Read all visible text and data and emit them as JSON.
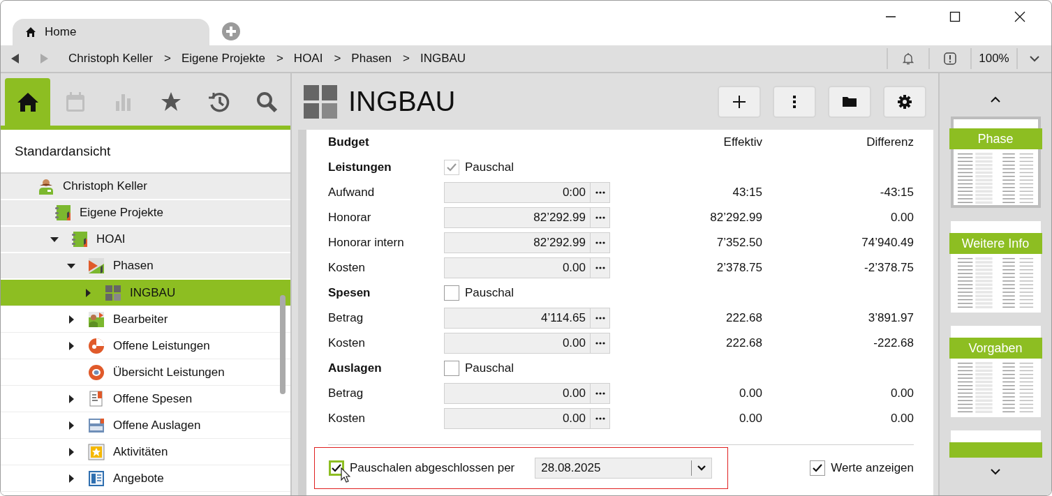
{
  "window": {
    "tabs": [
      {
        "label": "Home",
        "selected": true
      }
    ]
  },
  "breadcrumb": {
    "back_disabled": false,
    "forward_disabled": true,
    "items": [
      {
        "label": "Christoph Keller",
        "separator": ">"
      },
      {
        "label": "Eigene Projekte",
        "separator": ">"
      },
      {
        "label": "HOAI",
        "separator": ">"
      },
      {
        "label": "Phasen",
        "separator": ">"
      },
      {
        "label": "INGBAU"
      }
    ],
    "zoom": "100%"
  },
  "sidebar": {
    "tabs": [
      {
        "kind": "home",
        "selected": true,
        "disabled": false
      },
      {
        "kind": "calendar",
        "selected": false,
        "disabled": true
      },
      {
        "kind": "chart",
        "selected": false,
        "disabled": true
      },
      {
        "kind": "favorites",
        "selected": false,
        "disabled": false
      },
      {
        "kind": "history",
        "selected": false,
        "disabled": false
      },
      {
        "kind": "search",
        "selected": false,
        "disabled": false
      }
    ],
    "view_title": "Standardansicht",
    "tree": [
      {
        "label": "Christoph Keller",
        "kind": "person",
        "selected": false,
        "children": [
          {
            "label": "Eigene Projekte",
            "kind": "project",
            "selected": false,
            "children": [
              {
                "label": "HOAI",
                "kind": "project",
                "expanded": true,
                "selected": false,
                "children": [
                  {
                    "label": "Phasen",
                    "kind": "phases",
                    "expanded": true,
                    "selected": false,
                    "children": [
                      {
                        "label": "INGBAU",
                        "kind": "phase",
                        "expanded": false,
                        "selected": true
                      }
                    ]
                  },
                  {
                    "label": "Bearbeiter",
                    "kind": "staff",
                    "expanded": false,
                    "selected": false
                  },
                  {
                    "label": "Offene Leistungen",
                    "kind": "services",
                    "expanded": false,
                    "selected": false
                  },
                  {
                    "label": "Übersicht Leistungen",
                    "kind": "overview",
                    "selected": false
                  },
                  {
                    "label": "Offene Spesen",
                    "kind": "expenses",
                    "expanded": false,
                    "selected": false
                  },
                  {
                    "label": "Offene Auslagen",
                    "kind": "outlays",
                    "expanded": false,
                    "selected": false
                  },
                  {
                    "label": "Aktivitäten",
                    "kind": "activities",
                    "expanded": false,
                    "selected": false
                  },
                  {
                    "label": "Angebote",
                    "kind": "offers",
                    "expanded": false,
                    "selected": false
                  }
                ]
              }
            ]
          }
        ]
      }
    ]
  },
  "page": {
    "title": "INGBAU",
    "budget": {
      "columns": [
        "Budget",
        "Effektiv",
        "Differenz"
      ],
      "groups": [
        {
          "title": "Leistungen",
          "flat": {
            "label": "Pauschal",
            "checked": true,
            "disabled": true
          },
          "rows": [
            {
              "label": "Aufwand",
              "value": "0:00",
              "effective": "43:15",
              "difference": "-43:15"
            },
            {
              "label": "Honorar",
              "value": "82’292.99",
              "effective": "82’292.99",
              "difference": "0.00"
            },
            {
              "label": "Honorar intern",
              "value": "82’292.99",
              "effective": "7’352.50",
              "difference": "74’940.49"
            },
            {
              "label": "Kosten",
              "value": "0.00",
              "effective": "2’378.75",
              "difference": "-2’378.75"
            }
          ]
        },
        {
          "title": "Spesen",
          "flat": {
            "label": "Pauschal",
            "checked": false,
            "disabled": false
          },
          "rows": [
            {
              "label": "Betrag",
              "value": "4’114.65",
              "effective": "222.68",
              "difference": "3’891.97"
            },
            {
              "label": "Kosten",
              "value": "0.00",
              "effective": "222.68",
              "difference": "-222.68"
            }
          ]
        },
        {
          "title": "Auslagen",
          "flat": {
            "label": "Pauschal",
            "checked": false,
            "disabled": false
          },
          "rows": [
            {
              "label": "Betrag",
              "value": "0.00",
              "effective": "0.00",
              "difference": "0.00"
            },
            {
              "label": "Kosten",
              "value": "0.00",
              "effective": "0.00",
              "difference": "0.00"
            }
          ]
        }
      ]
    },
    "footer": {
      "highlighted": true,
      "closed": {
        "label": "Pauschalen abgeschlossen per",
        "checked": true,
        "focused": true
      },
      "date": "28.08.2025",
      "show_values": {
        "label": "Werte anzeigen",
        "checked": true
      }
    }
  },
  "thumbnails": [
    {
      "label": "Phase",
      "selected": true
    },
    {
      "label": "Weitere Info",
      "selected": false
    },
    {
      "label": "Vorgaben",
      "selected": false
    },
    {
      "selected": false
    }
  ]
}
